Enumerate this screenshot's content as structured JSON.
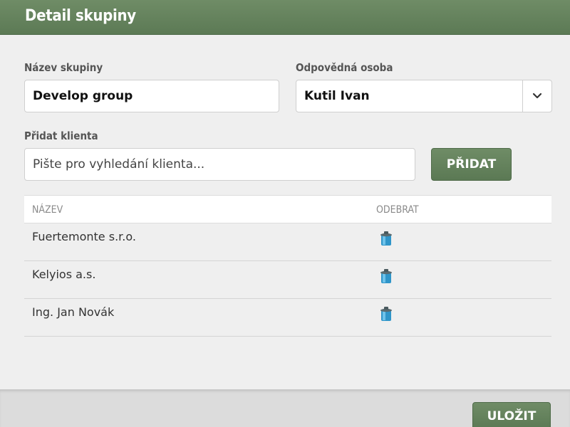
{
  "header": {
    "title": "Detail skupiny"
  },
  "form": {
    "group_name": {
      "label": "Název skupiny",
      "value": "Develop group"
    },
    "responsible": {
      "label": "Odpovědná osoba",
      "value": "Kutil Ivan"
    },
    "add_client": {
      "label": "Přidat klienta",
      "placeholder": "Pište pro vyhledání klienta...",
      "button": "PŘIDAT"
    }
  },
  "table": {
    "columns": [
      "NÁZEV",
      "ODEBRAT"
    ],
    "rows": [
      {
        "name": "Fuertemonte s.r.o.",
        "action_icon": "trash-icon"
      },
      {
        "name": "Kelyios a.s.",
        "action_icon": "trash-icon"
      },
      {
        "name": "Ing. Jan Novák",
        "action_icon": "trash-icon"
      }
    ]
  },
  "footer": {
    "save_button": "ULOŽIT"
  },
  "colors": {
    "accent": "#617f59",
    "header": "#637f5c",
    "background": "#efefef",
    "trash": "#3aa3d6"
  }
}
